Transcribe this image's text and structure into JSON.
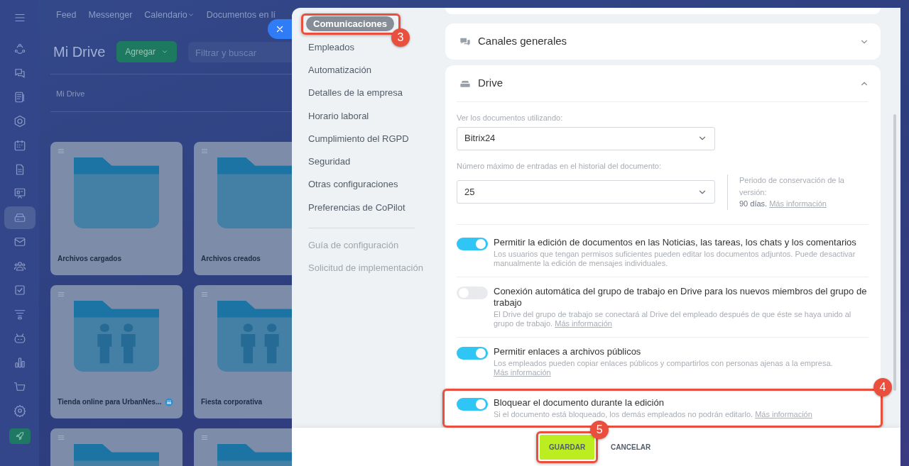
{
  "background_page": {
    "rail_items": [
      {
        "selected": false
      },
      {
        "selected": false
      },
      {
        "selected": false
      },
      {
        "selected": false
      },
      {
        "selected": false
      },
      {
        "selected": false
      },
      {
        "selected": false
      },
      {
        "selected": true
      },
      {
        "selected": false
      },
      {
        "selected": false
      },
      {
        "selected": false
      },
      {
        "selected": false
      },
      {
        "selected": false
      },
      {
        "selected": false
      },
      {
        "selected": false
      },
      {
        "selected": false
      }
    ],
    "top_nav": [
      {
        "label": "Feed",
        "dropdown": false
      },
      {
        "label": "Messenger",
        "dropdown": false
      },
      {
        "label": "Calendario",
        "dropdown": true
      },
      {
        "label": "Documentos en lí",
        "dropdown": false
      }
    ],
    "title": "Mi Drive",
    "add_button": "Agregar",
    "search": {
      "placeholder": "Filtrar y buscar"
    },
    "breadcrumb": "Mi Drive",
    "folders": [
      {
        "kind": "plain",
        "name": "Archivos cargados",
        "shared": false
      },
      {
        "kind": "plain",
        "name": "Archivos creados",
        "shared": false
      },
      {
        "kind": "group",
        "name": "Tienda online para UrbanNes...",
        "shared": true
      },
      {
        "kind": "group",
        "name": "Fiesta corporativa",
        "shared": false
      },
      {
        "kind": "plain"
      },
      {
        "kind": "plain"
      }
    ]
  },
  "settings_panel": {
    "menu": [
      {
        "label": "Comunicaciones",
        "selected": true,
        "callout": "3"
      },
      {
        "label": "Empleados",
        "selected": false
      },
      {
        "label": "Automatización",
        "selected": false
      },
      {
        "label": "Detalles de la empresa",
        "selected": false
      },
      {
        "label": "Horario laboral",
        "selected": false
      },
      {
        "label": "Cumplimiento del RGPD",
        "selected": false
      },
      {
        "label": "Seguridad",
        "selected": false
      },
      {
        "label": "Otras configuraciones",
        "selected": false
      },
      {
        "label": "Preferencias de CoPilot",
        "selected": false
      }
    ],
    "menu_secondary": [
      {
        "label": "Guía de configuración"
      },
      {
        "label": "Solicitud de implementación"
      }
    ],
    "sections": [
      {
        "kind": "chat",
        "title": "Canales generales",
        "expanded": false
      },
      {
        "kind": "drive",
        "title": "Drive",
        "expanded": true
      }
    ],
    "drive": {
      "selects": [
        {
          "label": "Ver los documentos utilizando:",
          "value": "Bitrix24"
        },
        {
          "label": "Número máximo de entradas en el historial del documento:",
          "value": "25"
        }
      ],
      "retention_note": {
        "label": "Periodo de conservación de la versión:",
        "value": "90 días.",
        "link": "Más información"
      },
      "toggles": [
        {
          "title": "Permitir la edición de documentos en las Noticias, las tareas, los chats y los comentarios",
          "description": "Los usuarios que tengan permisos suficientes pueden editar los documentos adjuntos. Puede desactivar manualmente la edición de mensajes individuales.",
          "on": true
        },
        {
          "title": "Conexión automática del grupo de trabajo en Drive para los nuevos miembros del grupo de trabajo",
          "description": "El Drive del grupo de trabajo se conectará al Drive del empleado después de que éste se haya unido al grupo de trabajo.",
          "link": "Más información",
          "on": false
        },
        {
          "title": "Permitir enlaces a archivos públicos",
          "description": "Los empleados pueden copiar enlaces públicos y compartirlos con personas ajenas a la empresa.",
          "link": "Más información",
          "on": true
        },
        {
          "title": "Bloquear el documento durante la edición",
          "description": "Si el documento está bloqueado, los demás empleados no podrán editarlo.",
          "link": "Más información",
          "on": true,
          "callout": "4"
        }
      ]
    },
    "footer": {
      "save": {
        "label": "GUARDAR",
        "callout": "5"
      },
      "cancel": {
        "label": "CANCELAR"
      }
    }
  }
}
